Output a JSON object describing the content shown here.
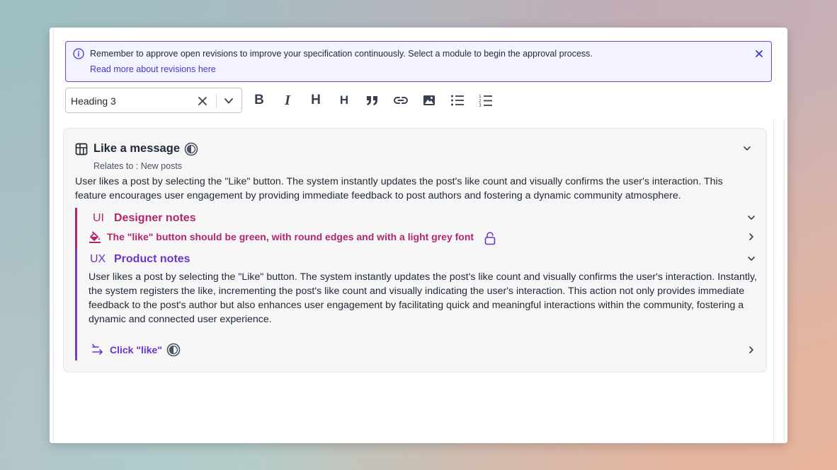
{
  "banner": {
    "message": "Remember to approve open revisions to improve your specification continuously. Select a module to begin the approval process.",
    "link": "Read more about revisions here",
    "border_color": "#5b4fe0",
    "background": "#f3f3ff"
  },
  "toolbar": {
    "block_type": "Heading 3",
    "buttons": [
      "bold-icon",
      "italic-icon",
      "heading-icon",
      "heading-small-icon",
      "quote-icon",
      "link-icon",
      "image-icon",
      "bullet-list-icon",
      "numbered-list-icon"
    ],
    "bold_label": "B",
    "italic_label": "I",
    "h1_label": "H",
    "h2_label": "H"
  },
  "card": {
    "title": "Like a message",
    "relates_to": "Relates to : New posts",
    "description": "User likes a post by selecting the \"Like\" button. The system instantly updates the post's like count and visually confirms the user's interaction. This feature encourages user engagement by providing immediate feedback to post authors and fostering a dynamic community atmosphere.",
    "ui_notes": {
      "tag": "UI",
      "heading": "Designer notes",
      "note": "The \"like\" button should be green, with round edges and with a light grey font",
      "color": "#b0276f"
    },
    "ux_notes": {
      "tag": "UX",
      "heading": "Product notes",
      "body": "User likes a post by selecting the \"Like\" button. The system instantly updates the post's like count and visually confirms the user's interaction. Instantly, the system registers the like, incrementing the post's like count and visually indicating the user's interaction. This action not only provides immediate feedback to the post's author but also enhances user engagement by facilitating quick and meaningful interactions within the community, fostering a dynamic and connected user experience.",
      "flow_label": "Click \"like\"",
      "color": "#6b35c7"
    }
  }
}
